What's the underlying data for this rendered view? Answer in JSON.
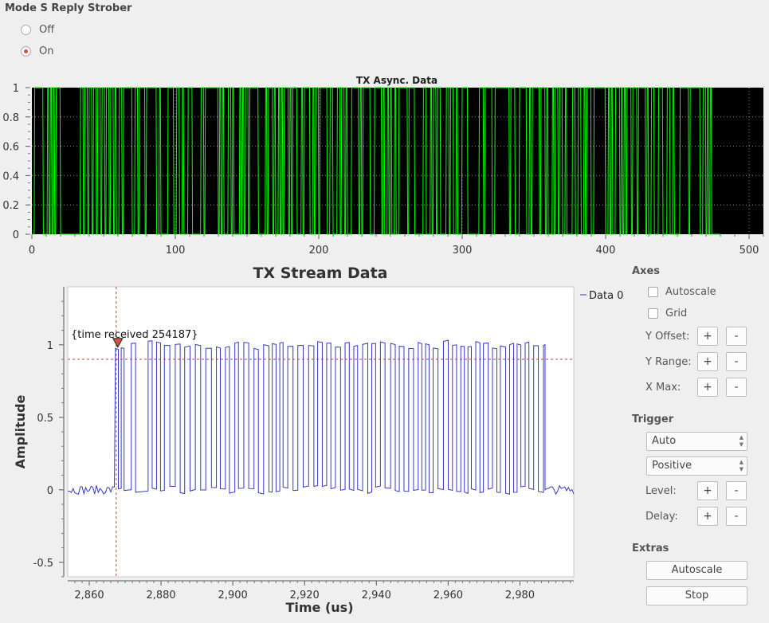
{
  "strober": {
    "title": "Mode S Reply Strober",
    "options": [
      {
        "label": "Off",
        "selected": false
      },
      {
        "label": "On",
        "selected": true
      }
    ]
  },
  "async_plot": {
    "title": "TX Async. Data",
    "y_ticks": [
      "1",
      "0.8",
      "0.6",
      "0.4",
      "0.2",
      "0"
    ],
    "x_ticks": [
      "0",
      "100",
      "200",
      "300",
      "400",
      "500"
    ],
    "colors": {
      "background": "#000000",
      "trace": "#00ff00"
    }
  },
  "stream_plot": {
    "title": "TX Stream Data",
    "xlabel": "Time (us)",
    "ylabel": "Amplitude",
    "x_ticks": [
      "2,860",
      "2,880",
      "2,900",
      "2,920",
      "2,940",
      "2,960",
      "2,980"
    ],
    "y_ticks": [
      "1",
      "0.5",
      "0",
      "-0.5"
    ],
    "legend": "Data 0",
    "tag_text": "{time received 254187}",
    "colors": {
      "trace": "#3838c8",
      "trigger": "#e03030",
      "tag_marker": "#d9503f"
    }
  },
  "chart_data": [
    {
      "type": "line",
      "title": "TX Async. Data",
      "xlabel": "",
      "ylabel": "",
      "xlim": [
        0,
        510
      ],
      "ylim": [
        0,
        1
      ],
      "grid": true,
      "series": [
        {
          "values_description_shown": "binary pulse stream between 0 and 1, samples 0 to ~480"
        }
      ]
    },
    {
      "type": "line",
      "title": "TX Stream Data",
      "xlabel": "Time (us)",
      "ylabel": "Amplitude",
      "xlim": [
        2854,
        2995
      ],
      "ylim": [
        -0.6,
        1.4
      ],
      "grid": false,
      "legend_position": "top-right",
      "series": [
        {
          "name": "Data 0"
        }
      ],
      "trigger": {
        "x": 2867.5,
        "y": 0.9
      },
      "pulse_region": [
        2867.5,
        2987
      ]
    }
  ],
  "controls": {
    "axes_title": "Axes",
    "autoscale_label": "Autoscale",
    "grid_label": "Grid",
    "y_offset_label": "Y Offset:",
    "y_range_label": "Y Range:",
    "x_max_label": "X Max:",
    "plus": "+",
    "minus": "-",
    "trigger_title": "Trigger",
    "trigger_mode": "Auto",
    "trigger_slope": "Positive",
    "level_label": "Level:",
    "delay_label": "Delay:",
    "extras_title": "Extras",
    "autoscale_button": "Autoscale",
    "stop_button": "Stop"
  }
}
